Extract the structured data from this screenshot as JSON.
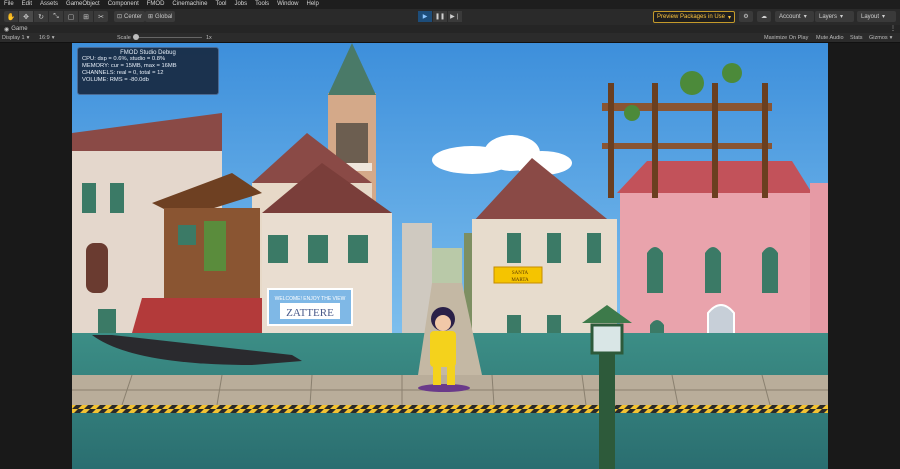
{
  "menubar": [
    "File",
    "Edit",
    "Assets",
    "GameObject",
    "Component",
    "FMOD",
    "Cinemachine",
    "Tool",
    "Jobs",
    "Tools",
    "Window",
    "Help"
  ],
  "toolbar": {
    "pivot_center": "Center",
    "pivot_global": "Global",
    "preview_packages": "Preview Packages in Use",
    "account": "Account",
    "layers": "Layers",
    "layout": "Layout"
  },
  "tab": {
    "game": "Game"
  },
  "game_options": {
    "display": "Display 1",
    "aspect": "16:9",
    "scale_label": "Scale",
    "scale_value": "1x",
    "maximize": "Maximize On Play",
    "mute": "Mute Audio",
    "stats": "Stats",
    "gizmos": "Gizmos"
  },
  "fmod_debug": {
    "title": "FMOD Studio Debug",
    "lines": [
      "CPU: dsp = 0.6%, studio = 0.8%",
      "MEMORY: cur = 15MB, max = 16MB",
      "CHANNELS: real = 0, total = 12",
      "VOLUME: RMS = -80.0db"
    ]
  },
  "scene_signs": {
    "banner_title": "WELCOME! ENJOY THE VIEW",
    "banner_name": "ZATTERE",
    "street_sign_1": "SANTA",
    "street_sign_2": "MARTA"
  },
  "colors": {
    "sky": "#4a9ee2",
    "water": "#3f8f8a",
    "pink_building": "#e9a3ac",
    "roof": "#8a4a46",
    "brand_warning": "#ffc53d",
    "debug_panel": "#16243a"
  }
}
